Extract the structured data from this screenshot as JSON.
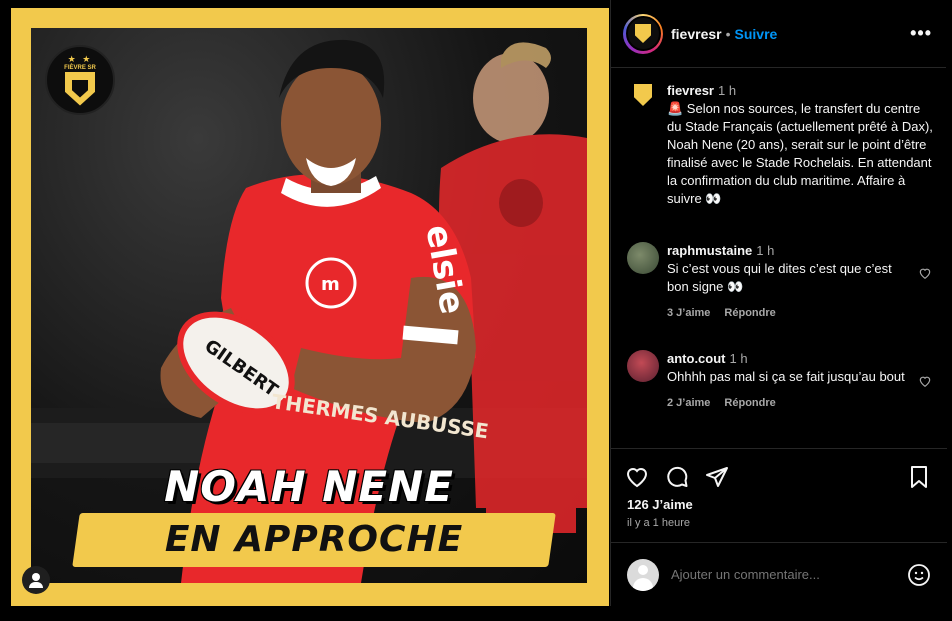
{
  "post": {
    "image": {
      "badge": {
        "stars": "★ ★",
        "name": "FIÈVRE SR"
      },
      "headline": "NOAH NENE",
      "subline": "EN APPROCHE",
      "ball_brand": "GILBERT",
      "shirt_sponsor": "elsie",
      "shirt_text": "THERMES AUBUSSE",
      "user_tag_icon": "user-icon"
    },
    "header": {
      "username": "fievresr",
      "separator": "•",
      "follow_label": "Suivre",
      "more_label": "•••"
    },
    "caption": {
      "username": "fievresr",
      "time": "1 h",
      "text": "🚨 Selon nos sources, le transfert du centre du Stade Français (actuellement prêté à Dax), Noah Nene (20 ans), serait sur le point d’être finalisé avec le Stade Rochelais. En attendant la confirmation du club maritime. Affaire à suivre 👀"
    },
    "comments": [
      {
        "username": "raphmustaine",
        "time": "1 h",
        "text": "Si c’est vous qui le dites c’est que c’est bon signe 👀",
        "likes": "3 J’aime",
        "reply": "Répondre"
      },
      {
        "username": "anto.cout",
        "time": "1 h",
        "text": "Ohhhh pas mal si ça se fait jusqu’au bout",
        "likes": "2 J’aime",
        "reply": "Répondre"
      }
    ],
    "likes": "126 J’aime",
    "posted": "il y a 1 heure",
    "add_comment_placeholder": "Ajouter un commentaire...",
    "colors": {
      "accent": "#0095f6",
      "frame": "#f2c94c",
      "jersey": "#e8282b"
    }
  }
}
